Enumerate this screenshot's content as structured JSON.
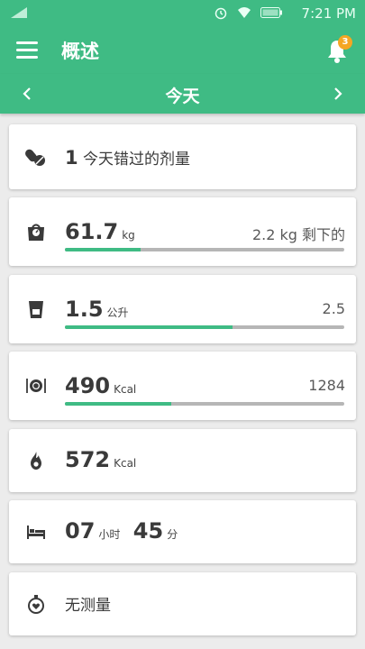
{
  "status_bar": {
    "time": "7:21 PM"
  },
  "app_bar": {
    "title": "概述",
    "notification_count": "3"
  },
  "date_nav": {
    "label": "今天"
  },
  "cards": {
    "missed_doses": {
      "count": "1",
      "text": "今天错过的剂量",
      "icon": "pills-icon"
    },
    "weight": {
      "value": "61.7",
      "unit": "kg",
      "remaining": "2.2 kg 剩下的",
      "progress": 0.27,
      "icon": "scale-icon"
    },
    "water": {
      "value": "1.5",
      "unit": "公升",
      "goal": "2.5",
      "progress": 0.6,
      "icon": "cup-icon"
    },
    "food": {
      "value": "490",
      "unit": "Kcal",
      "goal": "1284",
      "progress": 0.38,
      "icon": "plate-icon"
    },
    "burned": {
      "value": "572",
      "unit": "Kcal",
      "icon": "flame-icon"
    },
    "sleep": {
      "hours": "07",
      "hours_unit": "小时",
      "minutes": "45",
      "minutes_unit": "分",
      "icon": "bed-icon"
    },
    "measurement": {
      "text": "无测量",
      "icon": "stopwatch-heart-icon"
    }
  },
  "colors": {
    "primary": "#3fbb84",
    "badge": "#f5a623",
    "track": "#b6b6b6"
  }
}
